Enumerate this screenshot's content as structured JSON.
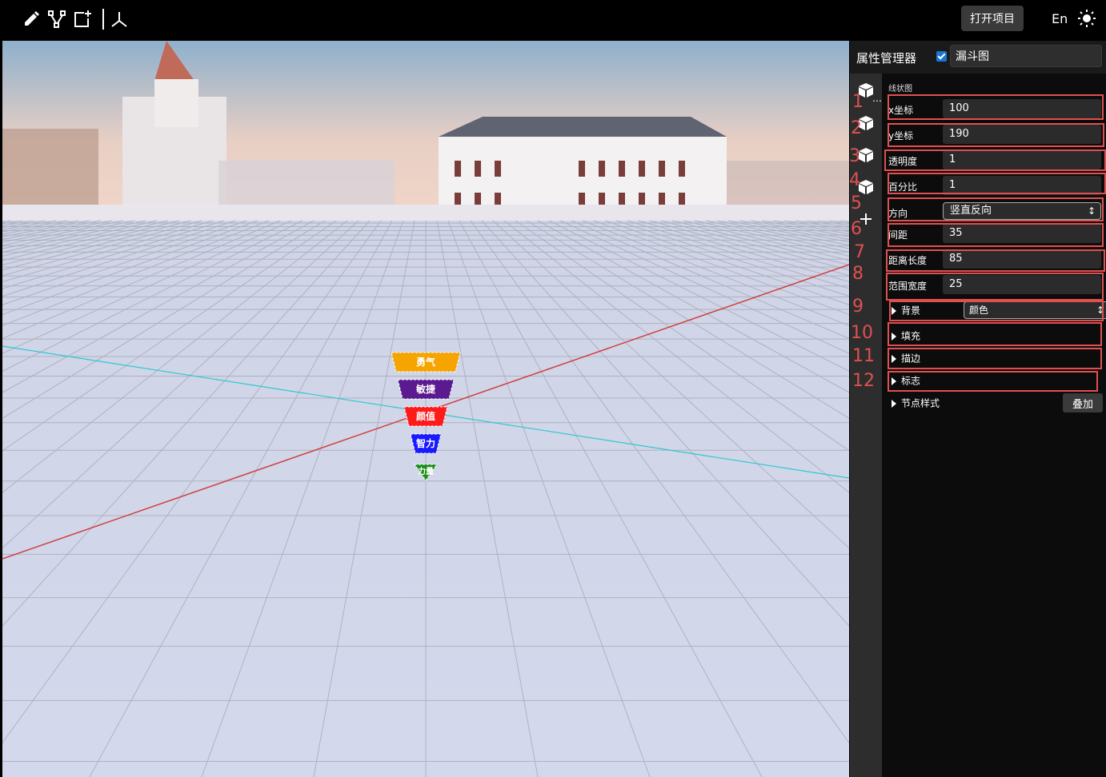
{
  "toolbar": {
    "icons": [
      "pencil-icon",
      "node-edit-icon",
      "add-frame-icon",
      "axis-icon"
    ],
    "open_project_label": "打开项目",
    "language_label": "En",
    "theme_icon": "sun-icon"
  },
  "viewport": {
    "funnel": [
      {
        "label": "勇气",
        "color": "#f5a400"
      },
      {
        "label": "敏捷",
        "color": "#5b1a8f"
      },
      {
        "label": "颜值",
        "color": "#ff1a1a"
      },
      {
        "label": "智力",
        "color": "#1a1aff"
      },
      {
        "label": "力量",
        "color": "#1a8f1a"
      }
    ]
  },
  "panel": {
    "title": "属性管理器",
    "visible_checked": true,
    "name": "漏斗图",
    "section": "线状图",
    "props": [
      {
        "label": "x坐标",
        "value": "100",
        "kind": "input"
      },
      {
        "label": "y坐标",
        "value": "190",
        "kind": "input"
      },
      {
        "label": "透明度",
        "value": "1",
        "kind": "input"
      },
      {
        "label": "百分比",
        "value": "1",
        "kind": "input"
      },
      {
        "label": "方向",
        "value": "竖直反向",
        "kind": "select"
      },
      {
        "label": "间距",
        "value": "35",
        "kind": "input"
      },
      {
        "label": "距离长度",
        "value": "85",
        "kind": "input"
      },
      {
        "label": "范围宽度",
        "value": "25",
        "kind": "input"
      }
    ],
    "background_label": "背景",
    "background_value": "颜色",
    "fill_label": "填充",
    "stroke_label": "描边",
    "marker_label": "标志",
    "node_style_label": "节点样式",
    "overlay_label": "叠加"
  },
  "annotations": [
    "1",
    "2",
    "3",
    "4",
    "5",
    "6",
    "7",
    "8",
    "9",
    "10",
    "11",
    "12"
  ]
}
